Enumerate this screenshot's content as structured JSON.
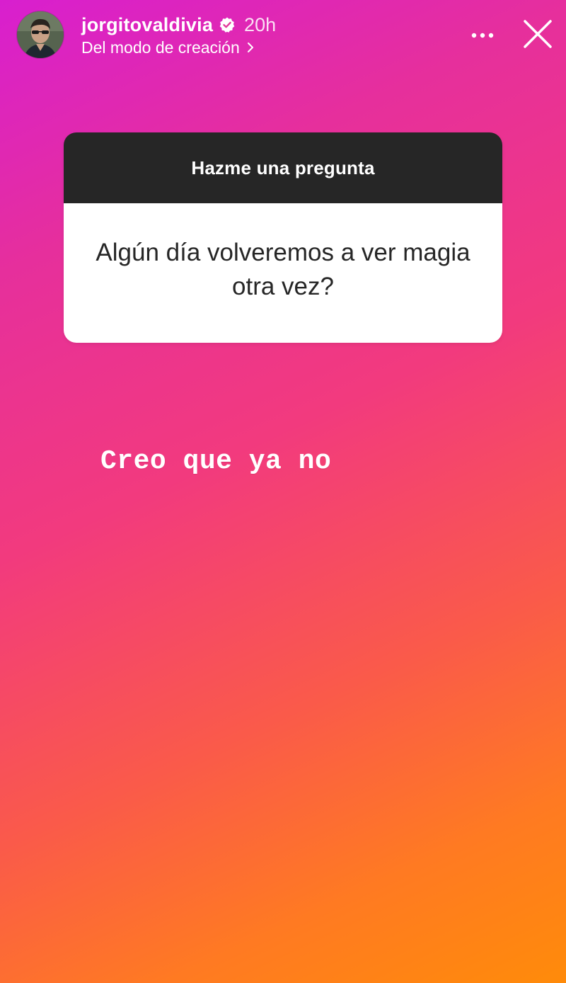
{
  "header": {
    "username": "jorgitovaldivia",
    "verified_icon": "verified-badge-icon",
    "time_ago": "20h",
    "subtitle": "Del modo de creación",
    "subtitle_icon": "chevron-right-icon",
    "more_icon": "more-horizontal-icon",
    "close_icon": "close-icon"
  },
  "question_sticker": {
    "label": "Hazme una pregunta",
    "question": "Algún día volveremos a ver magia otra vez?"
  },
  "answer": {
    "text": "Creo que ya no"
  },
  "colors": {
    "gradient_start": "#d81fcf",
    "gradient_mid": "#f23a7e",
    "gradient_end": "#ff8b0a",
    "sticker_header": "#262626",
    "sticker_body": "#ffffff"
  }
}
